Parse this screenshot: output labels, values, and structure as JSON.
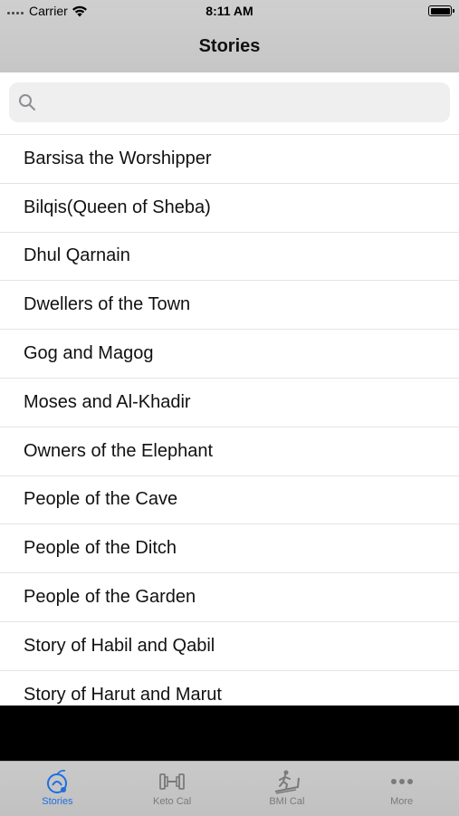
{
  "status_bar": {
    "carrier": "Carrier",
    "time": "8:11 AM"
  },
  "nav": {
    "title": "Stories"
  },
  "search": {
    "placeholder": ""
  },
  "stories": [
    "Barsisa the Worshipper",
    "Bilqis(Queen of Sheba)",
    "Dhul Qarnain",
    "Dwellers of the Town",
    "Gog and Magog",
    "Moses and Al-Khadir",
    "Owners of the Elephant",
    "People of the Cave",
    "People of the Ditch",
    "People of the Garden",
    "Story of Habil and Qabil",
    "Story of Harut and Marut"
  ],
  "tabs": [
    {
      "label": "Stories",
      "icon": "stories-icon",
      "active": true
    },
    {
      "label": "Keto Cal",
      "icon": "dumbbell-icon",
      "active": false
    },
    {
      "label": "BMI Cal",
      "icon": "treadmill-icon",
      "active": false
    },
    {
      "label": "More",
      "icon": "more-icon",
      "active": false
    }
  ],
  "colors": {
    "accent": "#1e6fe0",
    "inactive": "#7a7a7a"
  }
}
